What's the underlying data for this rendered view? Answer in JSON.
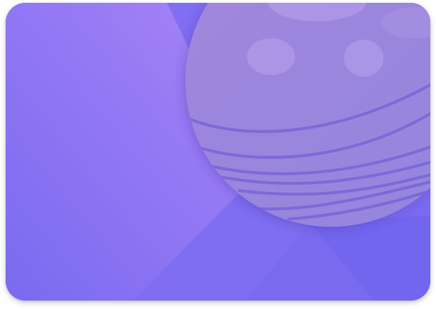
{
  "card": {
    "base_color": "#7a6af0",
    "light_facet_color": "#a583f6",
    "planet_color": "#9c86e0",
    "planet_ring_color": "#7b63d6",
    "planet_spot_color": "#b9a2ec"
  }
}
